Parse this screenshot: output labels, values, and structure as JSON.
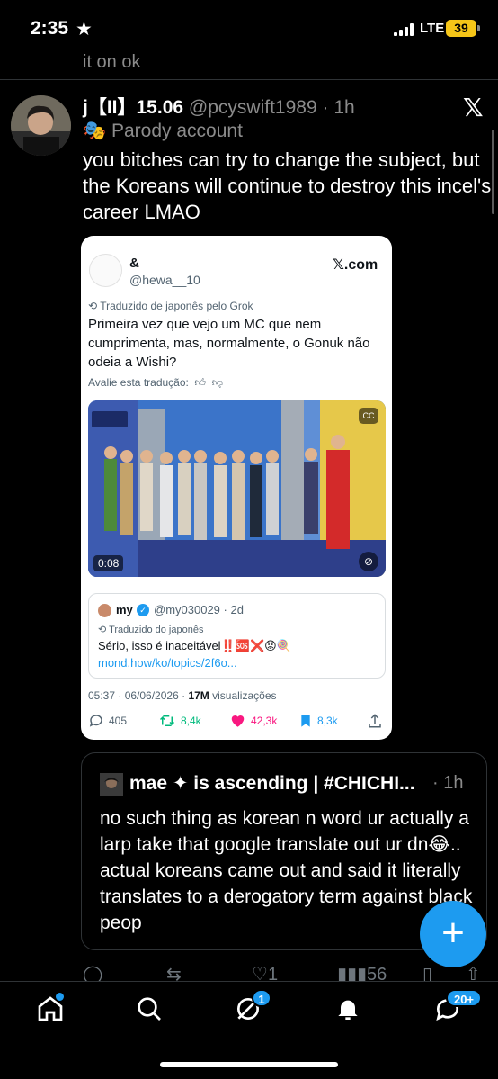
{
  "status_bar": {
    "time": "2:35",
    "network": "LTE",
    "battery": "39"
  },
  "previous_reply_tail": "it on ok",
  "tweet": {
    "display_name": "j【II】15.06",
    "handle": "@pcyswift1989",
    "time": "1h",
    "label": "Parody account",
    "text": "you bitches can try to change the subject, but the Koreans will continue to destroy this incel's career LMAO"
  },
  "screenshot": {
    "name": "&",
    "handle": "@hewa__10",
    "site": "𝕏.com",
    "translated_from": "Traduzido de japonês pelo Grok",
    "text": "Primeira vez que vejo um MC que nem cumprimenta, mas, normalmente, o Gonuk não odeia a Wishi?",
    "rate_translation": "Avalie esta tradução:",
    "video_duration": "0:08",
    "quoted": {
      "name": "my",
      "handle": "@my030029",
      "time": "2d",
      "translated": "Traduzido do japonês",
      "text": "Sério, isso é inaceitável‼️🆘❌😡🍭",
      "link": "mond.how/ko/topics/2f6o..."
    },
    "timestamp": "05:37 · 06/06/2026",
    "views_count": "17M",
    "views_label": "visualizações",
    "replies": "405",
    "reposts": "8,4k",
    "likes": "42,3k",
    "bookmarks": "8,3k"
  },
  "reply": {
    "display_name": "mae ✦ is ascending | #CHICHI...",
    "time": "· 1h",
    "text": "no such thing as korean n word ur actually a larp take that google translate out ur dn😂.. actual koreans came out and said it literally translates to a derogatory term against black peop"
  },
  "peek_actions": {
    "likes": "1",
    "views": "56"
  },
  "bottom_nav": {
    "grok_badge": "1",
    "messages_badge": "20+"
  },
  "colors": {
    "accent": "#1d9bf0",
    "like": "#f91880",
    "repost": "#00ba7c",
    "battery": "#f5c518"
  }
}
